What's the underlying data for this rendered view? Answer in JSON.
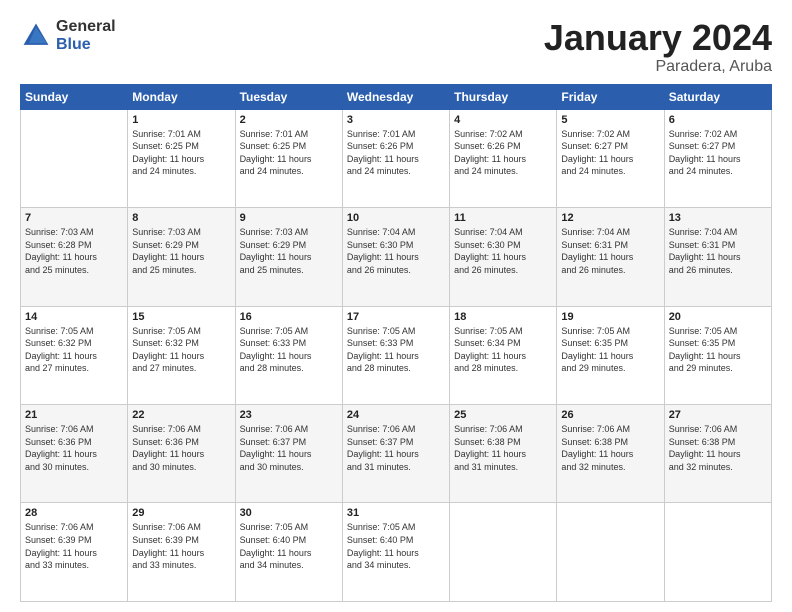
{
  "header": {
    "logo_general": "General",
    "logo_blue": "Blue",
    "title": "January 2024",
    "location": "Paradera, Aruba"
  },
  "days_of_week": [
    "Sunday",
    "Monday",
    "Tuesday",
    "Wednesday",
    "Thursday",
    "Friday",
    "Saturday"
  ],
  "weeks": [
    [
      {
        "day": "",
        "info": ""
      },
      {
        "day": "1",
        "info": "Sunrise: 7:01 AM\nSunset: 6:25 PM\nDaylight: 11 hours\nand 24 minutes."
      },
      {
        "day": "2",
        "info": "Sunrise: 7:01 AM\nSunset: 6:25 PM\nDaylight: 11 hours\nand 24 minutes."
      },
      {
        "day": "3",
        "info": "Sunrise: 7:01 AM\nSunset: 6:26 PM\nDaylight: 11 hours\nand 24 minutes."
      },
      {
        "day": "4",
        "info": "Sunrise: 7:02 AM\nSunset: 6:26 PM\nDaylight: 11 hours\nand 24 minutes."
      },
      {
        "day": "5",
        "info": "Sunrise: 7:02 AM\nSunset: 6:27 PM\nDaylight: 11 hours\nand 24 minutes."
      },
      {
        "day": "6",
        "info": "Sunrise: 7:02 AM\nSunset: 6:27 PM\nDaylight: 11 hours\nand 24 minutes."
      }
    ],
    [
      {
        "day": "7",
        "info": "Sunrise: 7:03 AM\nSunset: 6:28 PM\nDaylight: 11 hours\nand 25 minutes."
      },
      {
        "day": "8",
        "info": "Sunrise: 7:03 AM\nSunset: 6:29 PM\nDaylight: 11 hours\nand 25 minutes."
      },
      {
        "day": "9",
        "info": "Sunrise: 7:03 AM\nSunset: 6:29 PM\nDaylight: 11 hours\nand 25 minutes."
      },
      {
        "day": "10",
        "info": "Sunrise: 7:04 AM\nSunset: 6:30 PM\nDaylight: 11 hours\nand 26 minutes."
      },
      {
        "day": "11",
        "info": "Sunrise: 7:04 AM\nSunset: 6:30 PM\nDaylight: 11 hours\nand 26 minutes."
      },
      {
        "day": "12",
        "info": "Sunrise: 7:04 AM\nSunset: 6:31 PM\nDaylight: 11 hours\nand 26 minutes."
      },
      {
        "day": "13",
        "info": "Sunrise: 7:04 AM\nSunset: 6:31 PM\nDaylight: 11 hours\nand 26 minutes."
      }
    ],
    [
      {
        "day": "14",
        "info": "Sunrise: 7:05 AM\nSunset: 6:32 PM\nDaylight: 11 hours\nand 27 minutes."
      },
      {
        "day": "15",
        "info": "Sunrise: 7:05 AM\nSunset: 6:32 PM\nDaylight: 11 hours\nand 27 minutes."
      },
      {
        "day": "16",
        "info": "Sunrise: 7:05 AM\nSunset: 6:33 PM\nDaylight: 11 hours\nand 28 minutes."
      },
      {
        "day": "17",
        "info": "Sunrise: 7:05 AM\nSunset: 6:33 PM\nDaylight: 11 hours\nand 28 minutes."
      },
      {
        "day": "18",
        "info": "Sunrise: 7:05 AM\nSunset: 6:34 PM\nDaylight: 11 hours\nand 28 minutes."
      },
      {
        "day": "19",
        "info": "Sunrise: 7:05 AM\nSunset: 6:35 PM\nDaylight: 11 hours\nand 29 minutes."
      },
      {
        "day": "20",
        "info": "Sunrise: 7:05 AM\nSunset: 6:35 PM\nDaylight: 11 hours\nand 29 minutes."
      }
    ],
    [
      {
        "day": "21",
        "info": "Sunrise: 7:06 AM\nSunset: 6:36 PM\nDaylight: 11 hours\nand 30 minutes."
      },
      {
        "day": "22",
        "info": "Sunrise: 7:06 AM\nSunset: 6:36 PM\nDaylight: 11 hours\nand 30 minutes."
      },
      {
        "day": "23",
        "info": "Sunrise: 7:06 AM\nSunset: 6:37 PM\nDaylight: 11 hours\nand 30 minutes."
      },
      {
        "day": "24",
        "info": "Sunrise: 7:06 AM\nSunset: 6:37 PM\nDaylight: 11 hours\nand 31 minutes."
      },
      {
        "day": "25",
        "info": "Sunrise: 7:06 AM\nSunset: 6:38 PM\nDaylight: 11 hours\nand 31 minutes."
      },
      {
        "day": "26",
        "info": "Sunrise: 7:06 AM\nSunset: 6:38 PM\nDaylight: 11 hours\nand 32 minutes."
      },
      {
        "day": "27",
        "info": "Sunrise: 7:06 AM\nSunset: 6:38 PM\nDaylight: 11 hours\nand 32 minutes."
      }
    ],
    [
      {
        "day": "28",
        "info": "Sunrise: 7:06 AM\nSunset: 6:39 PM\nDaylight: 11 hours\nand 33 minutes."
      },
      {
        "day": "29",
        "info": "Sunrise: 7:06 AM\nSunset: 6:39 PM\nDaylight: 11 hours\nand 33 minutes."
      },
      {
        "day": "30",
        "info": "Sunrise: 7:05 AM\nSunset: 6:40 PM\nDaylight: 11 hours\nand 34 minutes."
      },
      {
        "day": "31",
        "info": "Sunrise: 7:05 AM\nSunset: 6:40 PM\nDaylight: 11 hours\nand 34 minutes."
      },
      {
        "day": "",
        "info": ""
      },
      {
        "day": "",
        "info": ""
      },
      {
        "day": "",
        "info": ""
      }
    ]
  ]
}
